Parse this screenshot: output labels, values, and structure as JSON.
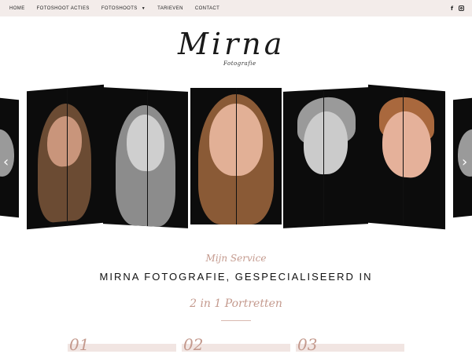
{
  "nav": {
    "items": [
      {
        "label": "HOME"
      },
      {
        "label": "FOTOSHOOT ACTIES"
      },
      {
        "label": "FOTOSHOOTS",
        "has_dropdown": true
      },
      {
        "label": "TARIEVEN"
      },
      {
        "label": "CONTACT"
      }
    ],
    "social": [
      "facebook-icon",
      "instagram-icon"
    ]
  },
  "logo": {
    "script": "Mirna",
    "subtitle": "Fotografie"
  },
  "carousel": {
    "prev_glyph": "‹",
    "next_glyph": "›"
  },
  "services": {
    "script_label": "Mijn Service",
    "heading": "MIRNA FOTOGRAFIE, GESPECIALISEERD IN",
    "script_sub": "2 in 1 Portretten",
    "numbers": [
      "01",
      "02",
      "03"
    ]
  },
  "colors": {
    "accent": "#c49a8e",
    "topbar": "#f3ecea"
  }
}
